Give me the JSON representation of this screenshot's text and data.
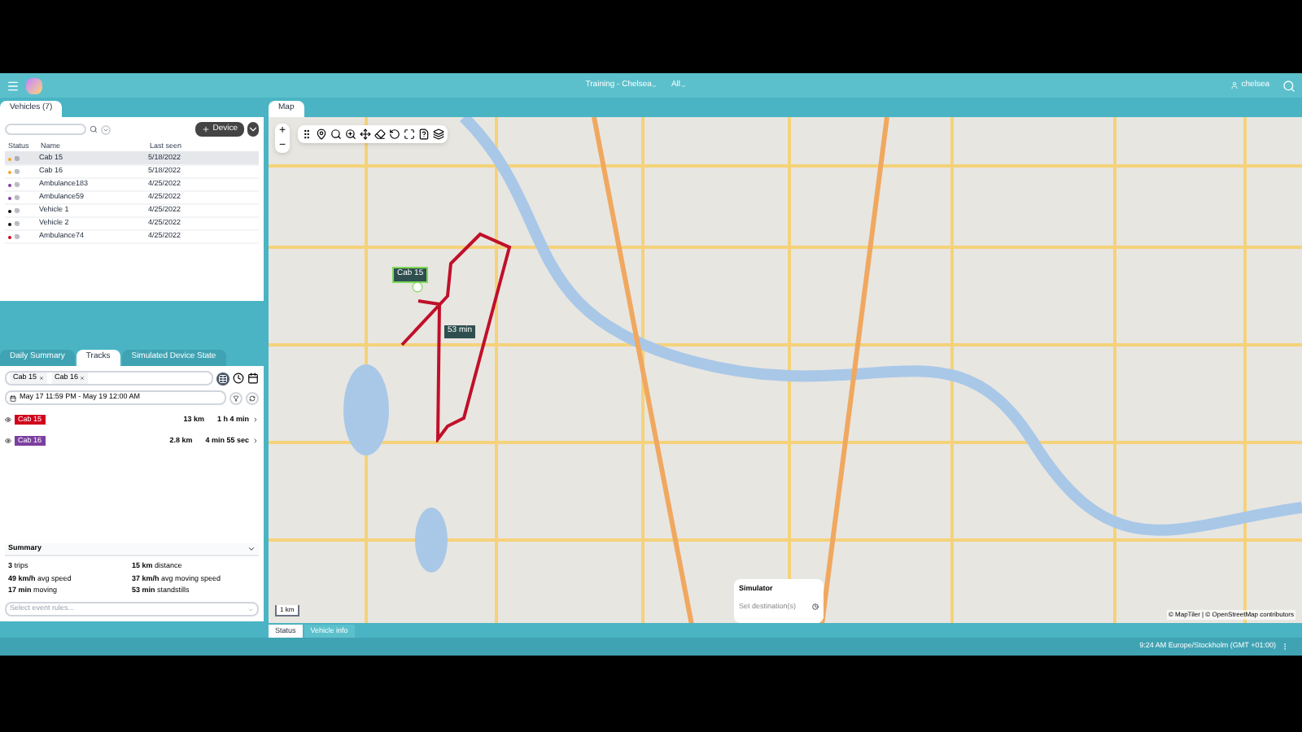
{
  "header": {
    "workspace": "Training - Chelsea",
    "filter": "All",
    "user": "chelsea"
  },
  "vehicles_panel": {
    "tab": "Vehicles (7)",
    "add_button": "Device",
    "columns": [
      "Status",
      "Name",
      "Last seen"
    ],
    "rows": [
      {
        "name": "Cab 15",
        "last_seen": "5/18/2022",
        "selected": true,
        "color": "#f5a623"
      },
      {
        "name": "Cab 16",
        "last_seen": "5/18/2022",
        "selected": false,
        "color": "#f5a623"
      },
      {
        "name": "Ambulance183",
        "last_seen": "4/25/2022",
        "selected": false,
        "color": "#7b3fa0"
      },
      {
        "name": "Ambulance59",
        "last_seen": "4/25/2022",
        "selected": false,
        "color": "#7b3fa0"
      },
      {
        "name": "Vehicle 1",
        "last_seen": "4/25/2022",
        "selected": false,
        "color": "#111111"
      },
      {
        "name": "Vehicle 2",
        "last_seen": "4/25/2022",
        "selected": false,
        "color": "#111111"
      },
      {
        "name": "Ambulance74",
        "last_seen": "4/25/2022",
        "selected": false,
        "color": "#d0021b"
      }
    ]
  },
  "tracks_panel": {
    "tabs": [
      {
        "label": "Daily Summary",
        "selected": false
      },
      {
        "label": "Tracks",
        "selected": true
      },
      {
        "label": "Simulated Device State",
        "selected": false
      }
    ],
    "chips": [
      "Cab 15",
      "Cab 16"
    ],
    "date_range": "May 17 11:59 PM - May 19 12:00 AM",
    "tracks": [
      {
        "name": "Cab 15",
        "color": "#d0021b",
        "distance": "13 km",
        "duration": "1 h 4 min"
      },
      {
        "name": "Cab 16",
        "color": "#7b3fa0",
        "distance": "2.8 km",
        "duration": "4 min 55 sec"
      }
    ],
    "summary": {
      "title": "Summary",
      "stats": [
        "**3** trips",
        "**15 km** distance",
        "**49 km/h** avg speed",
        "**37 km/h** avg moving speed",
        "**17 min** moving",
        "**53 min** standstills"
      ]
    },
    "event_rules": {
      "placeholder": "Select event rules..."
    }
  },
  "map_panel": {
    "tab": "Map",
    "zoom_in": "+",
    "zoom_out": "−",
    "vehicle_label": "Cab 15",
    "stop_label": "53 min",
    "scale": "1 km",
    "attribution": "© MapTiler | © OpenStreetMap contributors",
    "simulator": {
      "title": "Simulator",
      "placeholder": "Set destination(s)"
    }
  },
  "bottom_tabs": [
    {
      "label": "Status",
      "selected": true
    },
    {
      "label": "Vehicle info",
      "selected": false
    }
  ],
  "status_bar": {
    "time": "9:24 AM Europe/Stockholm (GMT +01:00)"
  }
}
